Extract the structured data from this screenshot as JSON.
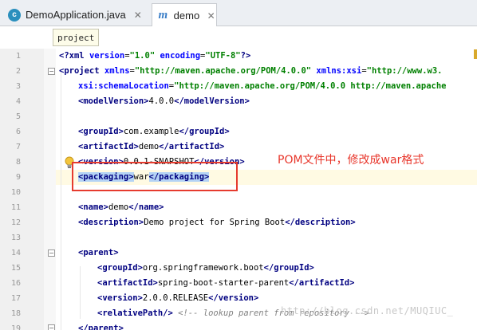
{
  "tabs": [
    {
      "label": "DemoApplication.java",
      "icon": "java-class-icon",
      "active": false
    },
    {
      "label": "demo",
      "icon": "maven-pom-icon",
      "active": true
    }
  ],
  "breadcrumb": "project",
  "annotation": "POM文件中，修改成war格式",
  "watermark": "http://blog.csdn.net/MUQIUC_",
  "line_numbers": [
    "1",
    "2",
    "3",
    "4",
    "5",
    "6",
    "7",
    "8",
    "9",
    "10",
    "11",
    "12",
    "13",
    "14",
    "15",
    "16",
    "17",
    "18",
    "19"
  ],
  "code": {
    "l1_decl": "<?xml ",
    "l1_a1": "version",
    "l1_v1": "\"1.0\"",
    "l1_a2": " encoding",
    "l1_v2": "\"UTF-8\"",
    "l1_end": "?>",
    "l2_tag": "<project ",
    "l2_a1": "xmlns",
    "l2_v1": "\"http://maven.apache.org/POM/4.0.0\"",
    "l2_a2": " xmlns:xsi",
    "l2_v2": "\"http://www.w3.",
    "l3_a1": "xsi:schemaLocation",
    "l3_v1": "\"http://maven.apache.org/POM/4.0.0 http://maven.apache",
    "modelVersion_open": "<modelVersion>",
    "modelVersion_val": "4.0.0",
    "modelVersion_close": "</modelVersion>",
    "groupId_open": "<groupId>",
    "groupId_val": "com.example",
    "groupId_close": "</groupId>",
    "artifactId_open": "<artifactId>",
    "artifactId_val": "demo",
    "artifactId_close": "</artifactId>",
    "version_open": "<version>",
    "version_val": "0.0.1-SNAPSHOT",
    "version_close": "</version>",
    "packaging_open": "<packaging>",
    "packaging_val": "war",
    "packaging_close": "</packaging>",
    "name_open": "<name>",
    "name_val": "demo",
    "name_close": "</name>",
    "description_open": "<description>",
    "description_val": "Demo project for Spring Boot",
    "description_close": "</description>",
    "parent_open": "<parent>",
    "p_groupId_val": "org.springframework.boot",
    "p_artifactId_val": "spring-boot-starter-parent",
    "p_version_val": "2.0.0.RELEASE",
    "relativePath": "<relativePath/>",
    "relativePath_comment": "<!-- lookup parent from repository -->",
    "parent_close": "</parent>"
  }
}
